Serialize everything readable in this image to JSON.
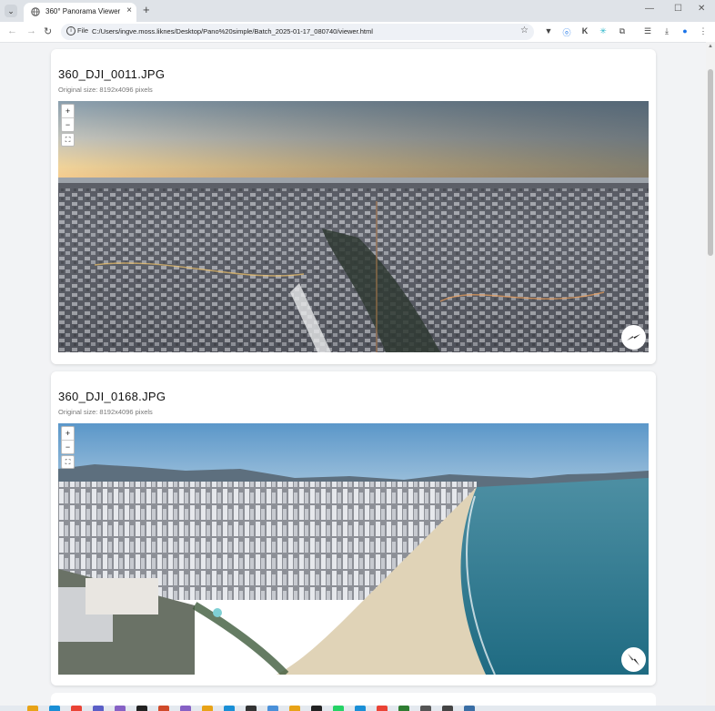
{
  "browser": {
    "tab_title": "360° Panorama Viewer",
    "new_tab_label": "+",
    "address_chip": "File",
    "url": "C:/Users/ingve.moss.liknes/Desktop/Pano%20simple/Batch_2025-01-17_080740/viewer.html"
  },
  "panoramas": [
    {
      "title": "360_DJI_0011.JPG",
      "subtitle": "Original size: 8192x4096 pixels",
      "scene": "winter-town-dusk"
    },
    {
      "title": "360_DJI_0168.JPG",
      "subtitle": "Original size: 8192x4096 pixels",
      "scene": "coastal-city-beach"
    }
  ],
  "viewer_controls": {
    "zoom_in": "+",
    "zoom_out": "−",
    "fullscreen": "⛶"
  },
  "colors": {
    "accent": "#1a73e8",
    "page_bg": "#f2f3f5"
  },
  "taskbar_icons": [
    "file-explorer-icon",
    "edge-icon",
    "chrome-icon",
    "teams-icon",
    "visual-studio-icon",
    "github-icon",
    "app-icon",
    "visual-studio-icon",
    "folder-icon",
    "vscode-icon",
    "terminal-icon",
    "app-icon",
    "folder-icon",
    "app-icon",
    "whatsapp-icon",
    "app-icon",
    "chrome-icon",
    "app-icon",
    "app-icon",
    "app-icon",
    "app-icon"
  ]
}
